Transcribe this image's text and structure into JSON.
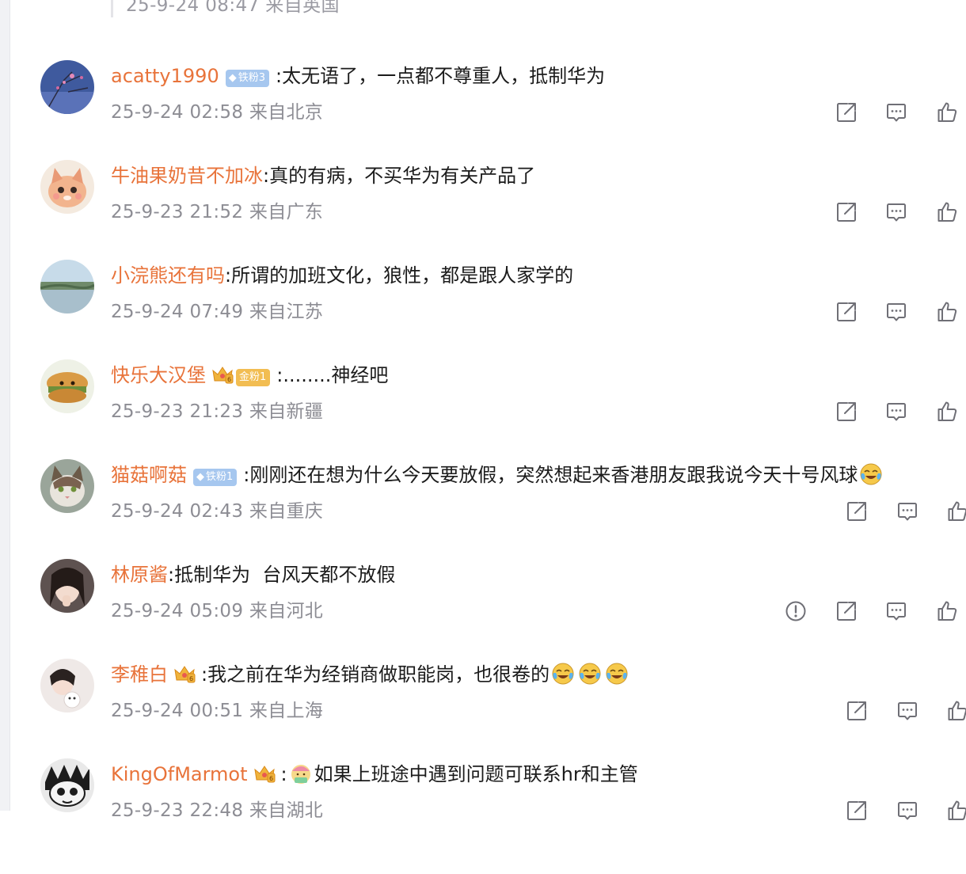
{
  "previous": {
    "meta": "25-9-24 08:47 来自英国"
  },
  "comments": [
    {
      "user": "acatty1990",
      "badge": "铁粉3",
      "text": ":太无语了，一点都不尊重人，抵制华为",
      "time": "25-9-24 02:58",
      "location": "来自北京"
    },
    {
      "user": "牛油果奶昔不加冰",
      "text": ":真的有病，不买华为有关产品了",
      "time": "25-9-23 21:52",
      "location": "来自广东"
    },
    {
      "user": "小浣熊还有吗",
      "text": ":所谓的加班文化，狼性，都是跟人家学的",
      "time": "25-9-24 07:49",
      "location": "来自江苏"
    },
    {
      "user": "快乐大汉堡",
      "badge": "金粉1",
      "text": ":........神经吧",
      "time": "25-9-23 21:23",
      "location": "来自新疆"
    },
    {
      "user": "猫菇啊菇",
      "badge": "铁粉1",
      "text": ":刚刚还在想为什么今天要放假，突然想起来香港朋友跟我说今天十号风球",
      "time": "25-9-24 02:43",
      "location": "来自重庆"
    },
    {
      "user": "林原酱",
      "text": ":抵制华为  台风天都不放假",
      "time": "25-9-24 05:09",
      "location": "来自河北"
    },
    {
      "user": "李稚白",
      "text": ":我之前在华为经销商做职能岗，也很卷的",
      "time": "25-9-24 00:51",
      "location": "来自上海"
    },
    {
      "user": "KingOfMarmot",
      "text": "如果上班途中遇到问题可联系hr和主管",
      "time": "25-9-23 22:48",
      "location": "来自湖北"
    }
  ],
  "icons": {
    "share": "share-icon",
    "reply": "comment-icon",
    "like": "thumbs-up-icon",
    "report": "report-icon",
    "emoji_cry": "laugh-cry-emoji",
    "emoji_hr": "work-emoji",
    "crown": "crown-vip-icon",
    "gem": "diamond-icon"
  },
  "colors": {
    "username": "#e8733a",
    "text": "#1b1b1b",
    "meta": "#8d8d94",
    "icon": "#6f6f76",
    "iron_badge": "#a6c7ef",
    "gold_badge": "#f2bd52"
  }
}
